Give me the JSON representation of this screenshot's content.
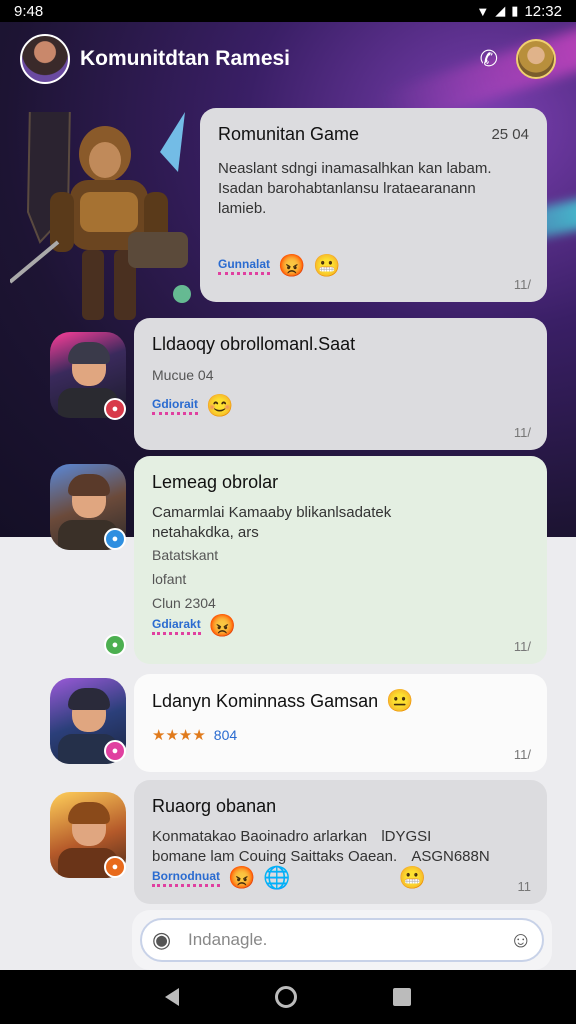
{
  "status": {
    "time": "9:48",
    "clock": "12:32"
  },
  "header": {
    "title": "Komunitdtan Ramesi"
  },
  "messages": [
    {
      "title": "Romunitan Game",
      "time": "25 04",
      "text_line1": "Neaslant sdngi inamasalhkan kan labam.",
      "text_line2": "Isadan barohabtanlansu lrataearanann",
      "text_line3": "lamieb.",
      "tag": "Gunnalat",
      "count": "11/"
    },
    {
      "title": "Lldaoqy obrollomanl.Saat",
      "meta": "Mucue 04",
      "tag": "Gdiorait",
      "count": "11/"
    },
    {
      "title": "Lemeag obrolar",
      "text_line1": "Camarmlai Kamaaby blikanlsadatek",
      "text_line2": "netahakdka, ars",
      "meta1": "Batatskant",
      "meta2": "lofant",
      "meta3": "Clun 2304",
      "tag": "Gdiarakt",
      "count": "11/"
    },
    {
      "title": "Ldanyn Kominnass Gamsan",
      "stars": "★★★★",
      "stars_num": "804",
      "count": "11/"
    },
    {
      "title": "Ruaorg obanan",
      "text_line1": "Konmatakao Baoinadro arlarkan",
      "text_line1b": "lDYGSI",
      "text_line2": "bomane lam Couing Saittaks Oaean.",
      "text_line2b": "ASGN688N",
      "tag": "Bornodnuat",
      "count": "11"
    }
  ],
  "input": {
    "placeholder": "Indanagle."
  }
}
